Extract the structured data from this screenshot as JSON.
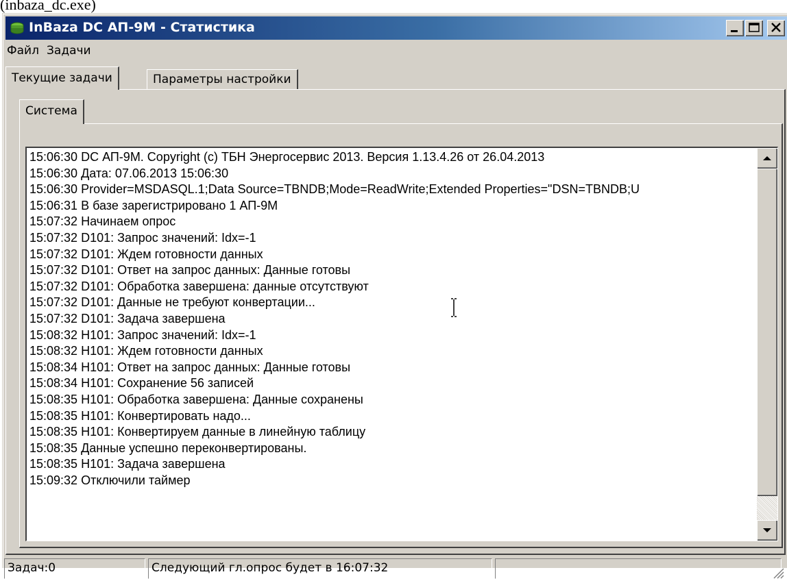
{
  "caption": "(inbaza_dc.exe)",
  "window": {
    "title": "InBaza DC АП-9М - Статистика",
    "controls": [
      "minimize-icon",
      "maximize-icon",
      "close-icon"
    ]
  },
  "menu": {
    "file": "Файл",
    "tasks": "Задачи"
  },
  "tabs": {
    "current_tasks": "Текущие задачи",
    "settings": "Параметры настройки",
    "system": "Система"
  },
  "log": {
    "lines": [
      "15:06:30  DC АП-9М. Copyright (c) ТБН Энергосервис 2013. Версия 1.13.4.26 от 26.04.2013",
      "15:06:30  Дата: 07.06.2013 15:06:30",
      "15:06:30  Provider=MSDASQL.1;Data Source=TBNDB;Mode=ReadWrite;Extended Properties=\"DSN=TBNDB;U",
      "15:06:31  В базе зарегистрировано 1 АП-9М",
      "15:07:32  Начинаем опрос",
      "15:07:32  D101: Запрос значений: Idx=-1",
      "15:07:32  D101: Ждем готовности данных",
      "15:07:32  D101: Ответ на запрос данных: Данные готовы",
      "15:07:32  D101: Обработка завершена: данные отсутствуют",
      "15:07:32  D101: Данные не требуют конвертации...",
      "15:07:32  D101: Задача завершена",
      "15:08:32  H101: Запрос значений: Idx=-1",
      "15:08:32  H101: Ждем готовности данных",
      "15:08:34  H101: Ответ на запрос данных: Данные готовы",
      "15:08:34  H101: Сохранение 56 записей",
      "15:08:35  H101: Обработка завершена: Данные сохранены",
      "15:08:35  H101: Конвертировать надо...",
      "15:08:35  H101: Конвертируем данные в линейную таблицу",
      "15:08:35  Данные успешно переконвертированы.",
      "15:08:35  H101: Задача завершена",
      "15:09:32  Отключили таймер"
    ]
  },
  "status": {
    "tasks": "Задач:0",
    "next_poll": "Следующий гл.опрос будет в 16:07:32",
    "empty": ""
  },
  "colors": {
    "titlebar_start": "#0a246a",
    "titlebar_end": "#a6caf0",
    "face": "#d4d0c8"
  }
}
